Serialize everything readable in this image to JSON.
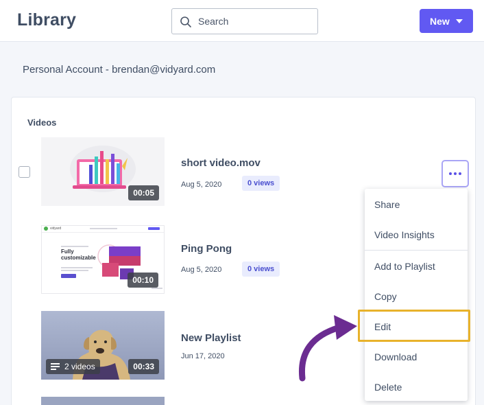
{
  "header": {
    "title": "Library",
    "search_placeholder": "Search",
    "new_label": "New"
  },
  "account_label": "Personal Account - brendan@vidyard.com",
  "section_title": "Videos",
  "videos": [
    {
      "title": "short video.mov",
      "date": "Aug 5, 2020",
      "views": "0 views",
      "duration": "00:05"
    },
    {
      "title": "Ping Pong",
      "date": "Aug 5, 2020",
      "views": "0 views",
      "duration": "00:10"
    },
    {
      "title": "New Playlist",
      "date": "Jun 17, 2020",
      "video_count": "2 videos",
      "duration": "00:33"
    }
  ],
  "menu_items": [
    "Share",
    "Video Insights",
    "Add to Playlist",
    "Copy",
    "Edit",
    "Download",
    "Delete"
  ],
  "thumb2_text": {
    "brand": "vidyard",
    "headline": "Fully customizable"
  },
  "colors": {
    "accent": "#6159f2",
    "highlight": "#e8b22b",
    "arrow": "#6b2c91",
    "views_badge": "#e9ecfd"
  },
  "icons": [
    "search-icon",
    "caret-down-icon",
    "more-dots-icon",
    "playlist-icon",
    "arrow-icon"
  ]
}
